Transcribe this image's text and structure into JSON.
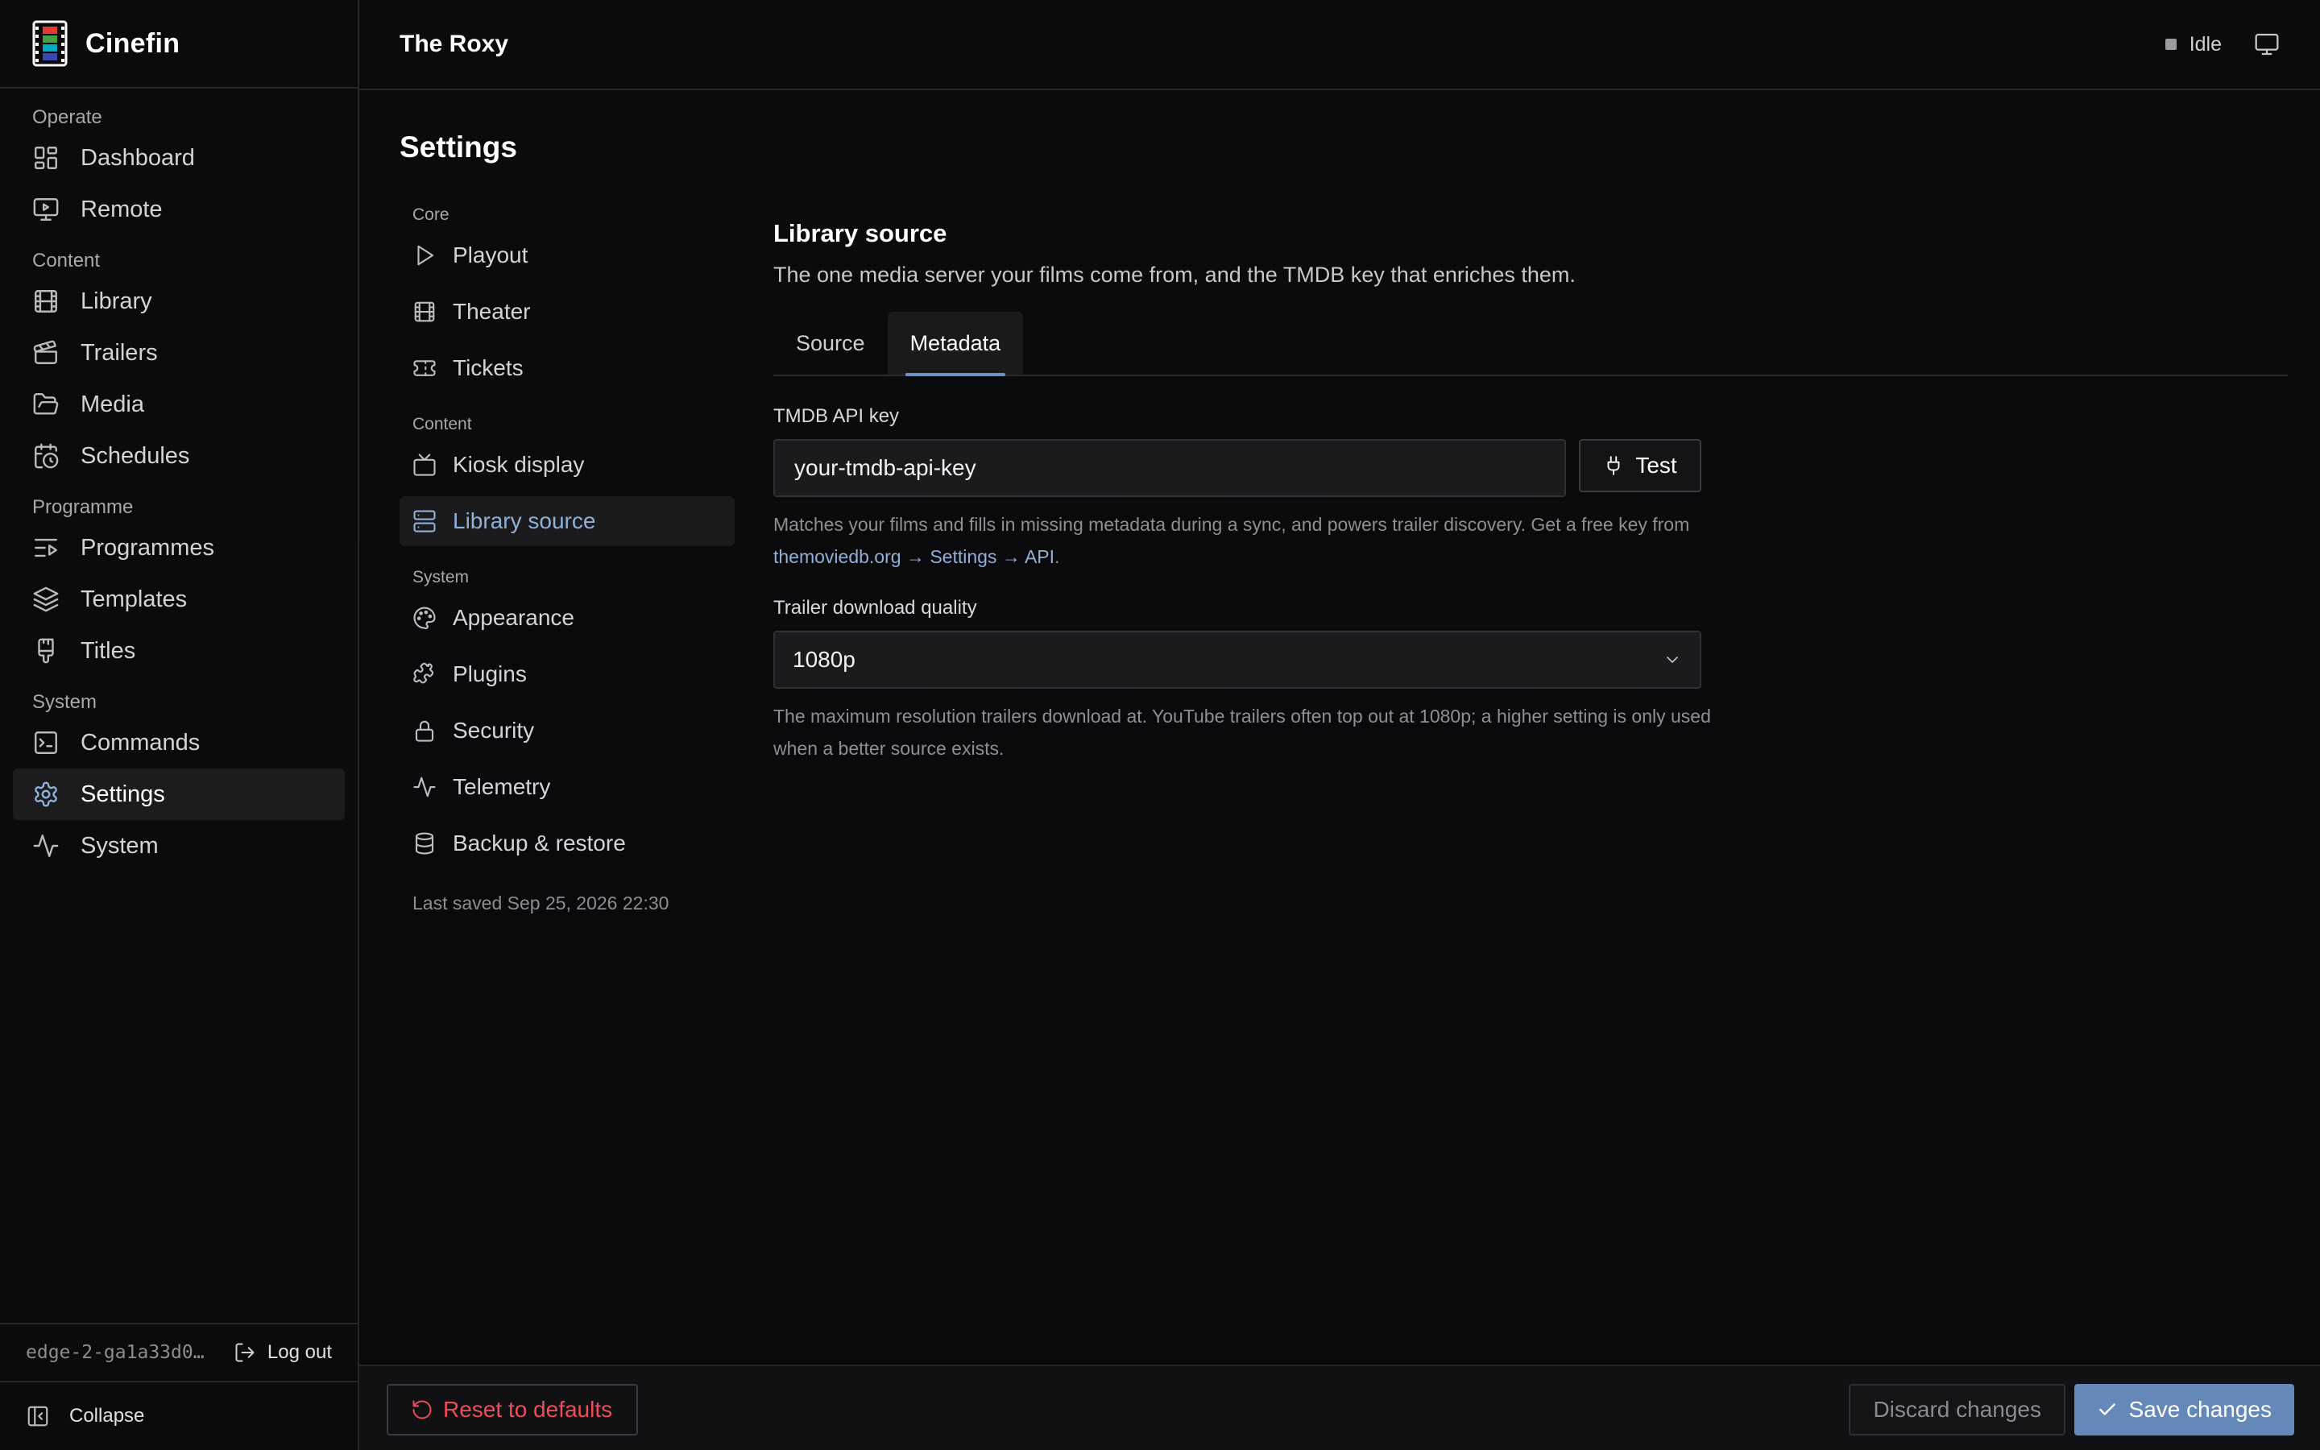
{
  "app": {
    "name": "Cinefin"
  },
  "colors": {
    "accent": "#6f94c4",
    "accent_text": "#8fb0d8",
    "danger": "#ef4c5a",
    "primary_button": "#6488b8"
  },
  "sidebar": {
    "sections": [
      {
        "label": "Operate",
        "items": [
          {
            "label": "Dashboard",
            "icon": "dashboard-icon"
          },
          {
            "label": "Remote",
            "icon": "remote-icon"
          }
        ]
      },
      {
        "label": "Content",
        "items": [
          {
            "label": "Library",
            "icon": "film-icon"
          },
          {
            "label": "Trailers",
            "icon": "clapperboard-icon"
          },
          {
            "label": "Media",
            "icon": "folder-icon"
          },
          {
            "label": "Schedules",
            "icon": "calendar-clock-icon"
          }
        ]
      },
      {
        "label": "Programme",
        "items": [
          {
            "label": "Programmes",
            "icon": "list-play-icon"
          },
          {
            "label": "Templates",
            "icon": "layers-icon"
          },
          {
            "label": "Titles",
            "icon": "brush-icon"
          }
        ]
      },
      {
        "label": "System",
        "items": [
          {
            "label": "Commands",
            "icon": "terminal-icon"
          },
          {
            "label": "Settings",
            "icon": "gear-icon",
            "active": true
          },
          {
            "label": "System",
            "icon": "activity-icon"
          }
        ]
      }
    ],
    "user": "edge-2-ga1a33d0…",
    "logout": "Log out",
    "collapse": "Collapse"
  },
  "topbar": {
    "venue": "The Roxy",
    "status": "Idle"
  },
  "page": {
    "title": "Settings"
  },
  "settings_nav": {
    "sections": [
      {
        "label": "Core",
        "items": [
          {
            "label": "Playout",
            "icon": "play-icon"
          },
          {
            "label": "Theater",
            "icon": "film-icon"
          },
          {
            "label": "Tickets",
            "icon": "ticket-icon"
          }
        ]
      },
      {
        "label": "Content",
        "items": [
          {
            "label": "Kiosk display",
            "icon": "tv-icon"
          },
          {
            "label": "Library source",
            "icon": "server-icon",
            "active": true
          }
        ]
      },
      {
        "label": "System",
        "items": [
          {
            "label": "Appearance",
            "icon": "palette-icon"
          },
          {
            "label": "Plugins",
            "icon": "puzzle-icon"
          },
          {
            "label": "Security",
            "icon": "lock-icon"
          },
          {
            "label": "Telemetry",
            "icon": "activity-icon"
          },
          {
            "label": "Backup & restore",
            "icon": "database-icon"
          }
        ]
      }
    ],
    "last_saved": "Last saved Sep 25, 2026 22:30"
  },
  "content": {
    "title": "Library source",
    "description": "The one media server your films come from, and the TMDB key that enriches them.",
    "tabs": [
      {
        "label": "Source"
      },
      {
        "label": "Metadata",
        "active": true
      }
    ],
    "tmdb": {
      "label": "TMDB API key",
      "value": "your-tmdb-api-key",
      "test_label": "Test",
      "help_prefix": "Matches your films and fills in missing metadata during a sync, and powers trailer discovery. Get a free key from ",
      "help_link": "themoviedb.org → Settings → API",
      "help_suffix": "."
    },
    "quality": {
      "label": "Trailer download quality",
      "value": "1080p",
      "help": "The maximum resolution trailers download at. YouTube trailers often top out at 1080p; a higher setting is only used when a better source exists."
    }
  },
  "footer": {
    "reset": "Reset to defaults",
    "discard": "Discard changes",
    "save": "Save changes"
  }
}
